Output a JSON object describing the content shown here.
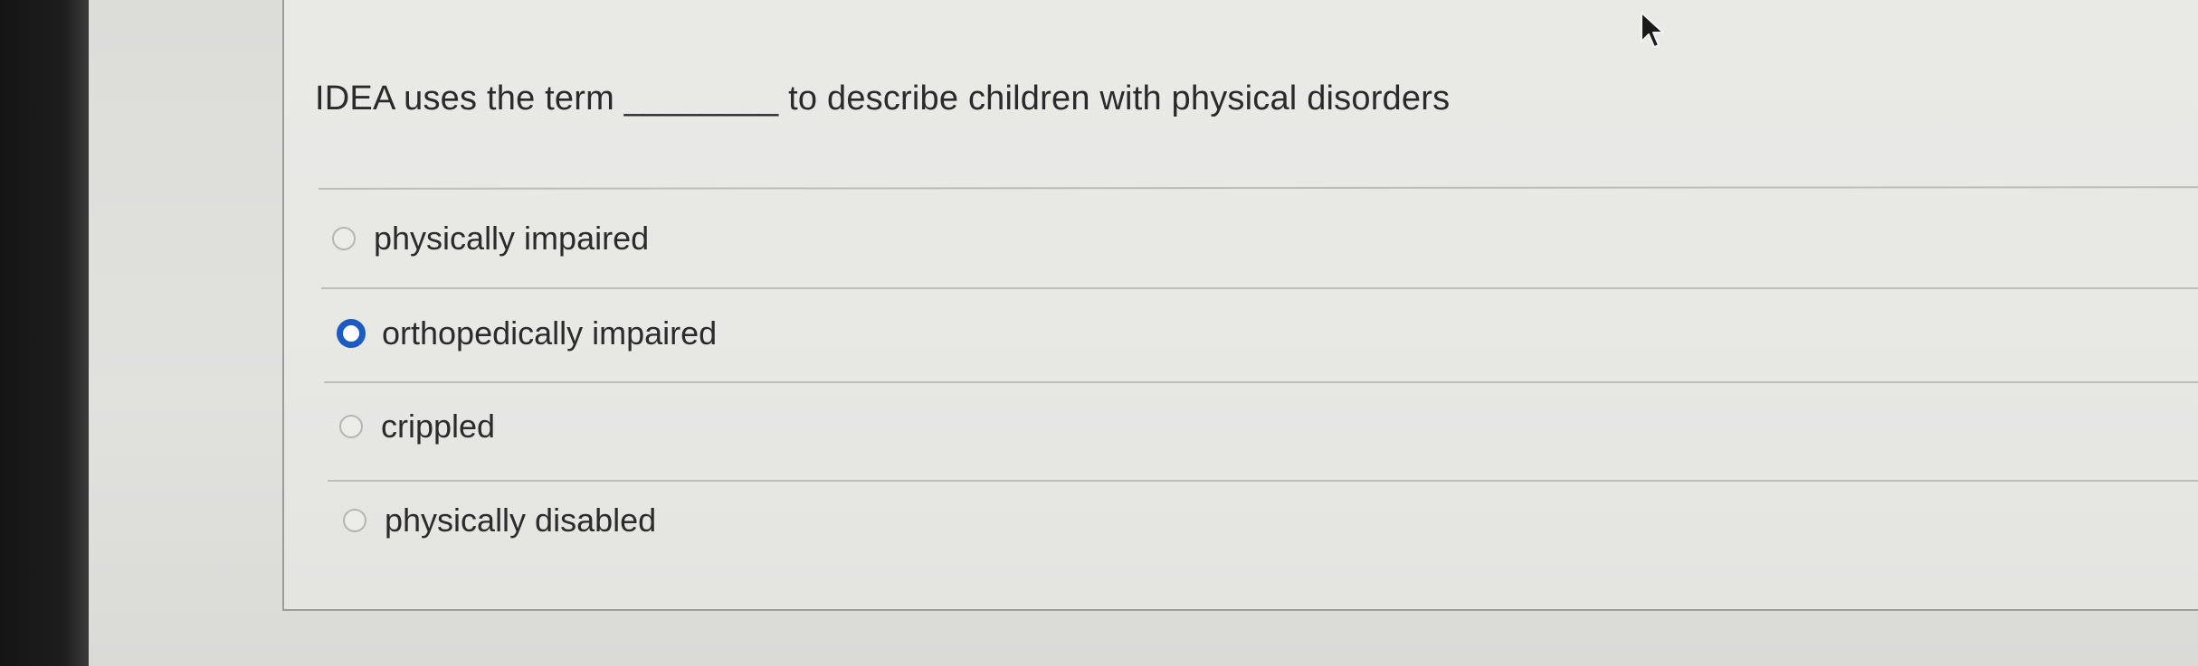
{
  "question": {
    "text": "IDEA uses the term ________ to describe children with physical disorders"
  },
  "options": [
    {
      "label": "physically impaired",
      "selected": false
    },
    {
      "label": "orthopedically impaired",
      "selected": true
    },
    {
      "label": "crippled",
      "selected": false
    },
    {
      "label": "physically disabled",
      "selected": false
    }
  ],
  "colors": {
    "selected_radio": "#1c5ac4"
  },
  "icons": {
    "cursor": "mouse-pointer-icon"
  }
}
